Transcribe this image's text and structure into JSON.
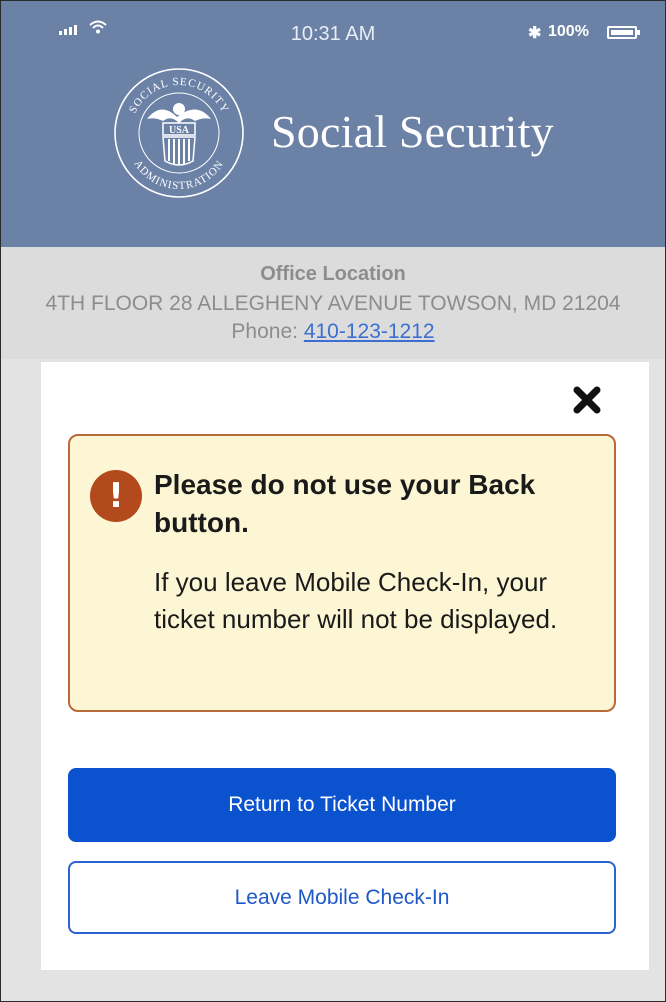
{
  "status_bar": {
    "time": "10:31 AM",
    "battery": "100%",
    "icons": [
      "signal-icon",
      "wifi-icon",
      "bluetooth-icon",
      "battery-icon"
    ]
  },
  "header": {
    "title": "Social Security",
    "seal": {
      "top_text": "SOCIAL SECURITY",
      "bottom_text": "ADMINISTRATION",
      "center_text": "USA"
    }
  },
  "office": {
    "title": "Office Location",
    "address": "4TH FLOOR 28 ALLEGHENY AVENUE TOWSON, MD 21204",
    "phone_label": "Phone:",
    "phone_number": "410-123-1212"
  },
  "modal": {
    "close_icon": "close-icon",
    "alert": {
      "icon": "exclamation-icon",
      "heading": "Please do not use your Back button.",
      "body": "If you leave Mobile Check-In, your ticket number will not be displayed."
    },
    "primary_button": "Return to Ticket Number",
    "secondary_button": "Leave Mobile Check-In"
  },
  "colors": {
    "header_bg": "#6b82a6",
    "primary": "#0b52cf",
    "alert_bg": "#fdf6d4",
    "alert_border": "#b86a3a",
    "alert_icon": "#b24a1e"
  }
}
